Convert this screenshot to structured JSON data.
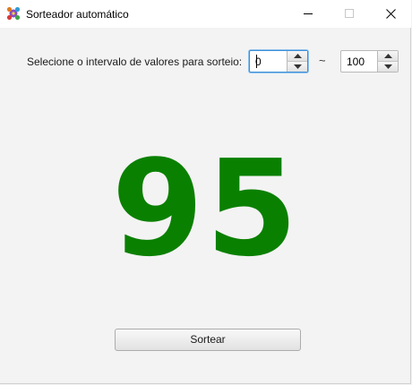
{
  "window": {
    "title": "Sorteador automático",
    "icon": "dice-app-icon",
    "controls": [
      "minimize-icon",
      "maximize-icon",
      "close-icon"
    ]
  },
  "range": {
    "label": "Selecione o intervalo de valores para sorteio:",
    "min_value": "0",
    "separator": "~",
    "max_value": "100"
  },
  "result": {
    "value": "95",
    "color": "#0a8000"
  },
  "actions": {
    "draw_label": "Sortear"
  }
}
